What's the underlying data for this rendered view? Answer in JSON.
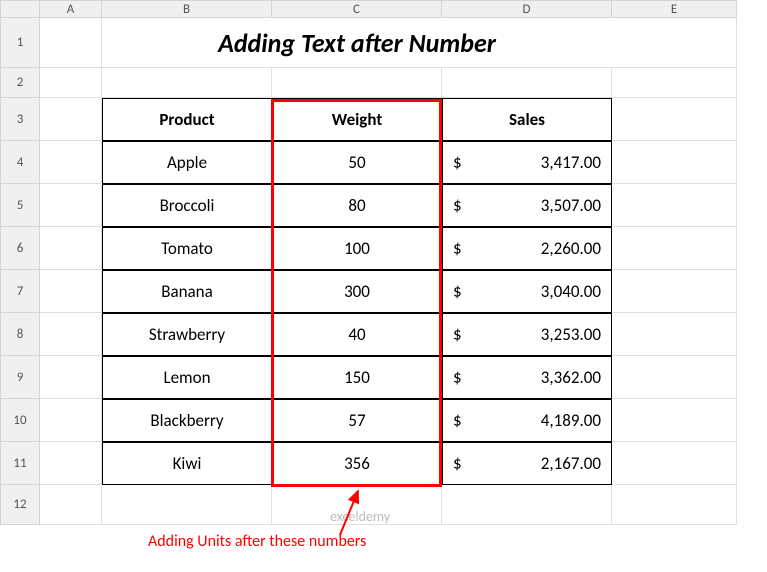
{
  "columns": [
    "A",
    "B",
    "C",
    "D",
    "E"
  ],
  "rows": [
    "1",
    "2",
    "3",
    "4",
    "5",
    "6",
    "7",
    "8",
    "9",
    "10",
    "11",
    "12"
  ],
  "title": "Adding Text after Number",
  "headers": {
    "product": "Product",
    "weight": "Weight",
    "sales": "Sales"
  },
  "data": [
    {
      "product": "Apple",
      "weight": "50",
      "sales_sym": "$",
      "sales_val": "3,417.00"
    },
    {
      "product": "Broccoli",
      "weight": "80",
      "sales_sym": "$",
      "sales_val": "3,507.00"
    },
    {
      "product": "Tomato",
      "weight": "100",
      "sales_sym": "$",
      "sales_val": "2,260.00"
    },
    {
      "product": "Banana",
      "weight": "300",
      "sales_sym": "$",
      "sales_val": "3,040.00"
    },
    {
      "product": "Strawberry",
      "weight": "40",
      "sales_sym": "$",
      "sales_val": "3,253.00"
    },
    {
      "product": "Lemon",
      "weight": "150",
      "sales_sym": "$",
      "sales_val": "3,362.00"
    },
    {
      "product": "Blackberry",
      "weight": "57",
      "sales_sym": "$",
      "sales_val": "4,189.00"
    },
    {
      "product": "Kiwi",
      "weight": "356",
      "sales_sym": "$",
      "sales_val": "2,167.00"
    }
  ],
  "annotation": "Adding Units after these numbers",
  "watermark": "exceldemy",
  "chart_data": {
    "type": "table",
    "title": "Adding Text after Number",
    "columns": [
      "Product",
      "Weight",
      "Sales"
    ],
    "rows": [
      [
        "Apple",
        50,
        3417.0
      ],
      [
        "Broccoli",
        80,
        3507.0
      ],
      [
        "Tomato",
        100,
        2260.0
      ],
      [
        "Banana",
        300,
        3040.0
      ],
      [
        "Strawberry",
        40,
        3253.0
      ],
      [
        "Lemon",
        150,
        3362.0
      ],
      [
        "Blackberry",
        57,
        4189.0
      ],
      [
        "Kiwi",
        356,
        2167.0
      ]
    ]
  }
}
